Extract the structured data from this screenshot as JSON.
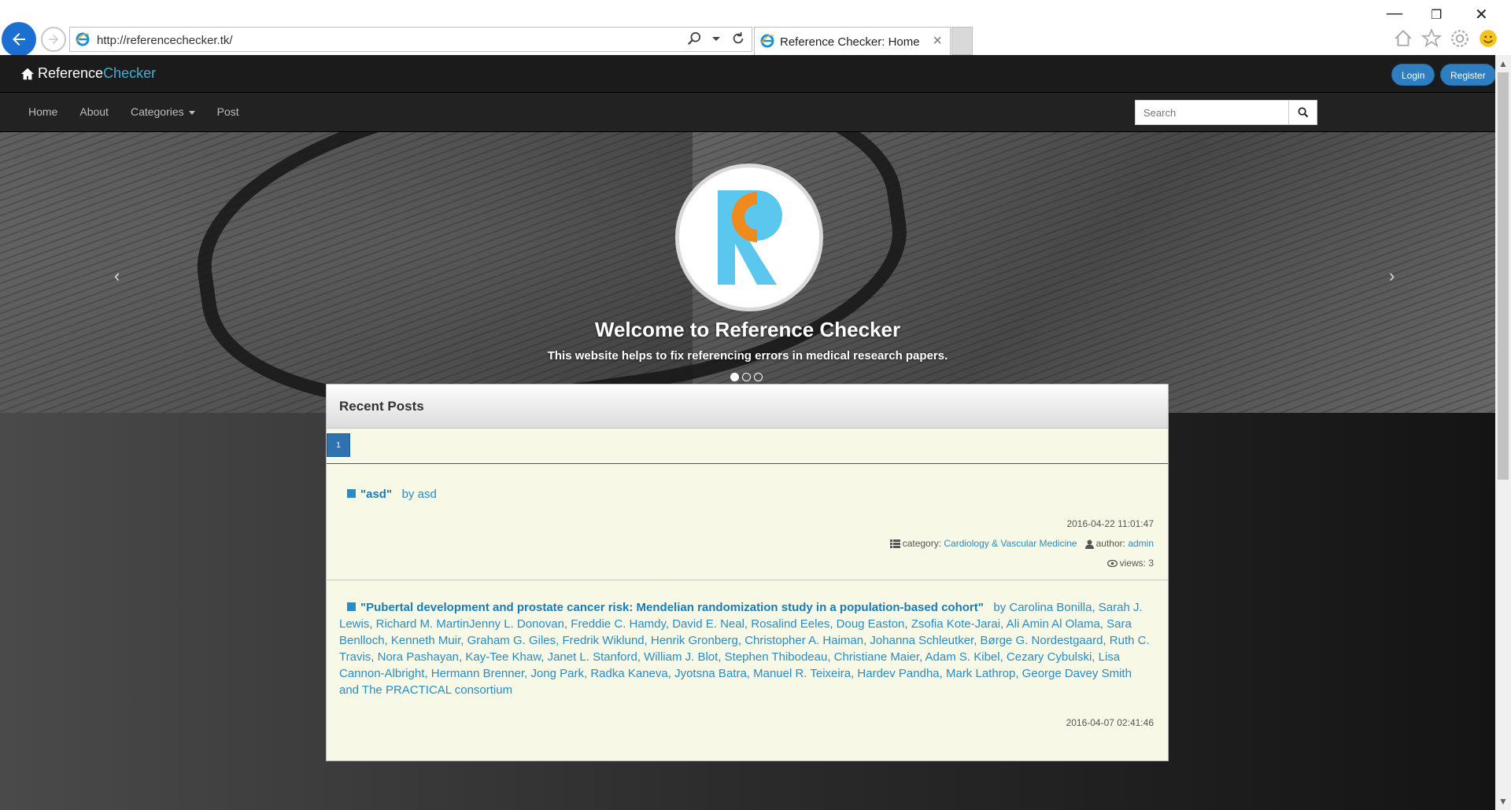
{
  "browser": {
    "url": "http://referencechecker.tk/",
    "tab_title": "Reference Checker: Home"
  },
  "site": {
    "brand_main": "Reference",
    "brand_accent": "Checker",
    "login_label": "Login",
    "register_label": "Register",
    "accent_color": "#3cb0dc"
  },
  "nav": {
    "items": [
      "Home",
      "About",
      "Categories",
      "Post"
    ],
    "search_placeholder": "Search"
  },
  "hero": {
    "title": "Welcome to Reference Checker",
    "subtitle": "This website helps to fix referencing errors in medical research papers.",
    "slides": 3,
    "active_slide": 1
  },
  "recent_posts": {
    "heading": "Recent Posts",
    "current_page": "1",
    "posts": [
      {
        "title": "\"asd\"",
        "byline": "by asd",
        "date": "2016-04-22 11:01:47",
        "category_label": "category:",
        "category": "Cardiology & Vascular Medicine",
        "author_label": "author:",
        "author": "admin",
        "views": "views: 3"
      },
      {
        "title": "\"Pubertal development and prostate cancer risk: Mendelian randomization study in a population-based cohort\"",
        "byline": "by Carolina Bonilla, Sarah J. Lewis, Richard M. MartinJenny L. Donovan, Freddie C. Hamdy, David E. Neal, Rosalind Eeles, Doug Easton, Zsofia Kote-Jarai, Ali Amin Al Olama, Sara Benlloch, Kenneth Muir, Graham G. Giles, Fredrik Wiklund, Henrik Gronberg, Christopher A. Haiman, Johanna Schleutker, Børge G. Nordestgaard, Ruth C. Travis, Nora Pashayan, Kay-Tee Khaw, Janet L. Stanford, William J. Blot, Stephen Thibodeau, Christiane Maier, Adam S. Kibel, Cezary Cybulski, Lisa Cannon-Albright, Hermann Brenner, Jong Park, Radka Kaneva, Jyotsna Batra, Manuel R. Teixeira, Hardev Pandha, Mark Lathrop, George Davey Smith and The PRACTICAL consortium",
        "date": "2016-04-07 02:41:46"
      }
    ]
  }
}
